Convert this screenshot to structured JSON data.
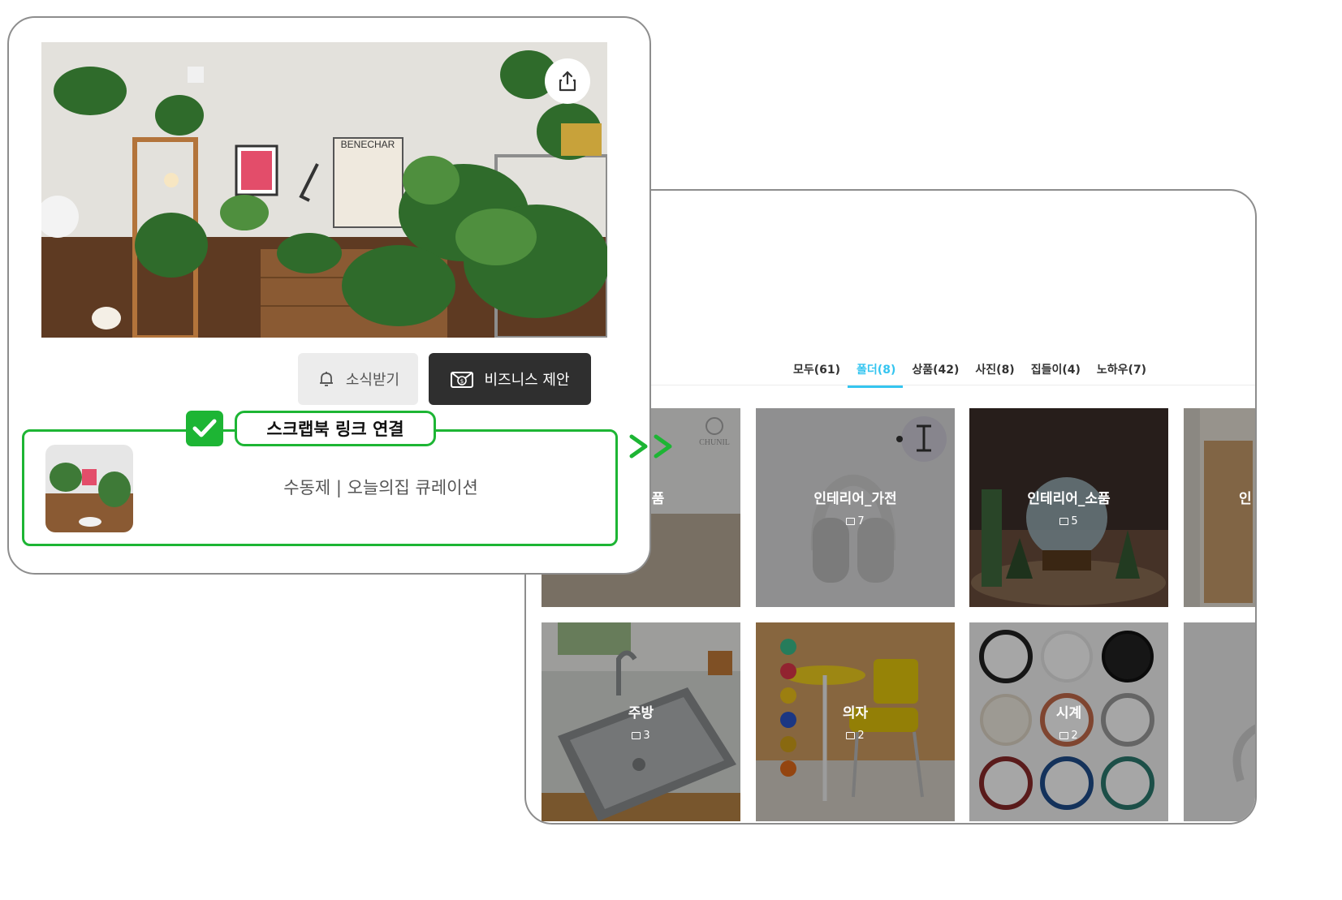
{
  "profile": {
    "follow_label": "소식받기",
    "business_label": "비즈니스 제안",
    "scrapbook_label": "스크랩북 링크 연결",
    "link_text": "수동제 | 오늘의집 큐레이션"
  },
  "photo_poster_text": "BENECHAR",
  "scrapbook": {
    "tabs": [
      {
        "label": "모두(61)"
      },
      {
        "label": "폴더(8)"
      },
      {
        "label": "상품(42)"
      },
      {
        "label": "사진(8)"
      },
      {
        "label": "집들이(4)"
      },
      {
        "label": "노하우(7)"
      }
    ],
    "active_tab": "폴더(8)",
    "folders": [
      {
        "title": "제품",
        "brand": "CHUNIL"
      },
      {
        "title": "인테리어_가전",
        "count": "7"
      },
      {
        "title": "인테리어_소품",
        "count": "5"
      },
      {
        "title": "인"
      },
      {
        "title": "주방",
        "count": "3"
      },
      {
        "title": "의자",
        "count": "2"
      },
      {
        "title": "시계",
        "count": "2"
      },
      {
        "title": ""
      }
    ]
  },
  "colors": {
    "accent_green": "#1db534",
    "tab_active": "#35c5f0",
    "business_button": "#2f2f2f"
  },
  "icons": {
    "share": "share-icon",
    "bell": "bell-icon",
    "business": "briefcase-icon",
    "check": "check-icon",
    "arrow": "double-chevron-right-icon"
  }
}
